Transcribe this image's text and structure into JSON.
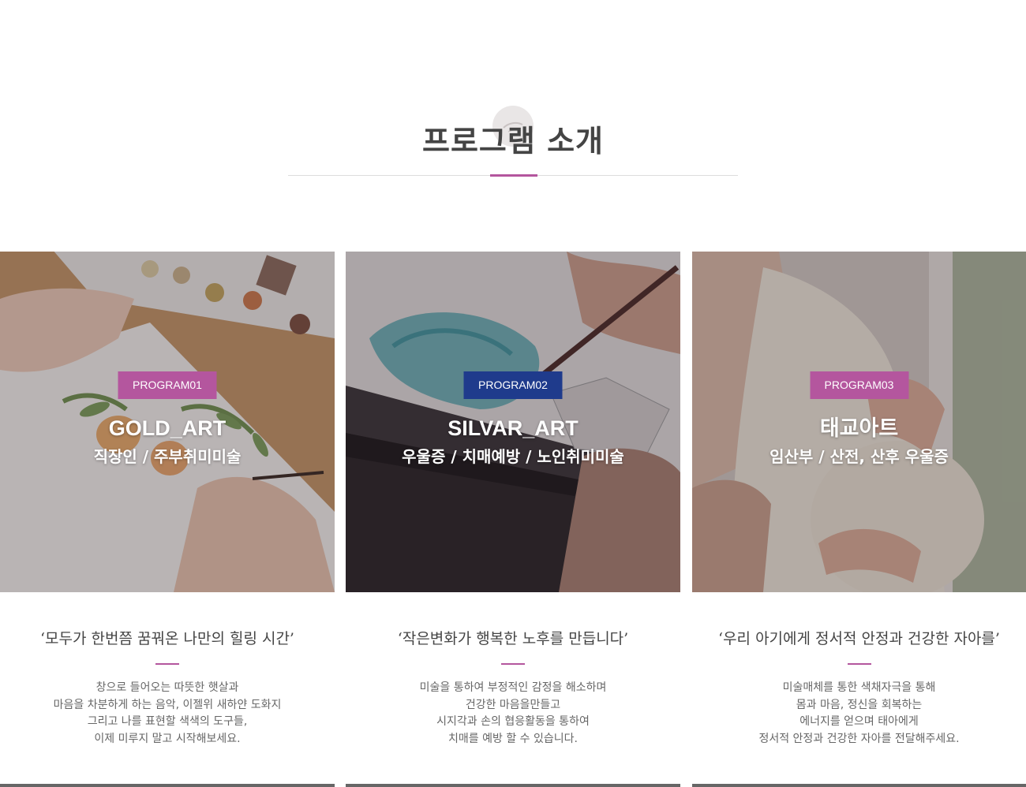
{
  "section": {
    "title": "프로그램 소개"
  },
  "colors": {
    "accent": "#b4569e",
    "badge_purple": "#b4569e",
    "badge_navy": "#1f3b8c"
  },
  "cards": [
    {
      "badge": "PROGRAM01",
      "name": "GOLD_ART",
      "subtitle": "직장인 / 주부취미미술",
      "quote": "‘모두가 한번쯤 꿈꿔온 나만의 힐링 시간’",
      "desc": [
        "창으로 들어오는 따뜻한 햇살과",
        "마음을 차분하게 하는 음악, 이젤위 새하얀 도화지",
        "그리고 나를 표현할 색색의 도구들,",
        "이제 미루지 말고 시작해보세요."
      ]
    },
    {
      "badge": "PROGRAM02",
      "name": "SILVAR_ART",
      "subtitle": "우울증 / 치매예방 / 노인취미미술",
      "quote": "‘작은변화가 행복한 노후를 만듭니다’",
      "desc": [
        "미술을 통하여 부정적인 감정을 해소하며",
        "건강한 마음을만들고",
        "시지각과 손의 협응활동을 통하여",
        "치매를 예방 할 수 있습니다."
      ]
    },
    {
      "badge": "PROGRAM03",
      "name": "태교아트",
      "subtitle": "임산부 / 산전, 산후 우울증",
      "quote": "‘우리 아기에게 정서적 안정과 건강한 자아를’",
      "desc": [
        "미술매체를 통한 색채자극을 통해",
        "몸과 마음, 정신을 회복하는",
        "에너지를 얻으며 태아에게",
        "정서적 안정과 건강한 자아를 전달해주세요."
      ]
    }
  ]
}
